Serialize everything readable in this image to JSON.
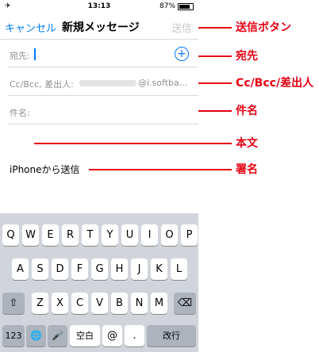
{
  "status_bar": {
    "signal": "✈ ",
    "time": "13:13",
    "battery": "87%"
  },
  "nav": {
    "cancel": "キャンセル",
    "title": "新規メッセージ",
    "send": "送信"
  },
  "fields": {
    "to_label": "宛先:",
    "cc_label": "Cc/Bcc, 差出人:",
    "from_suffix": "@i.softba...",
    "subject_label": "件名:",
    "add_icon": "+"
  },
  "signature": "iPhoneから送信",
  "keyboard": {
    "row1": [
      "Q",
      "W",
      "E",
      "R",
      "T",
      "Y",
      "U",
      "I",
      "O",
      "P"
    ],
    "row2": [
      "A",
      "S",
      "D",
      "F",
      "G",
      "H",
      "J",
      "K",
      "L"
    ],
    "row3": [
      "Z",
      "X",
      "C",
      "V",
      "B",
      "N",
      "M"
    ],
    "shift": "⇧",
    "backspace": "⌫",
    "num": "123",
    "globe": "🌐",
    "mic": "🎤",
    "space": "空白",
    "at": "@",
    "dot": ".",
    "return": "改行"
  },
  "annotations": {
    "send": "送信ボタン",
    "to": "宛先",
    "cc": "Cc/Bcc/差出人",
    "subject": "件名",
    "body": "本文",
    "signature": "署名"
  },
  "annotation_color": "#e60012",
  "accent_color": "#007aff"
}
